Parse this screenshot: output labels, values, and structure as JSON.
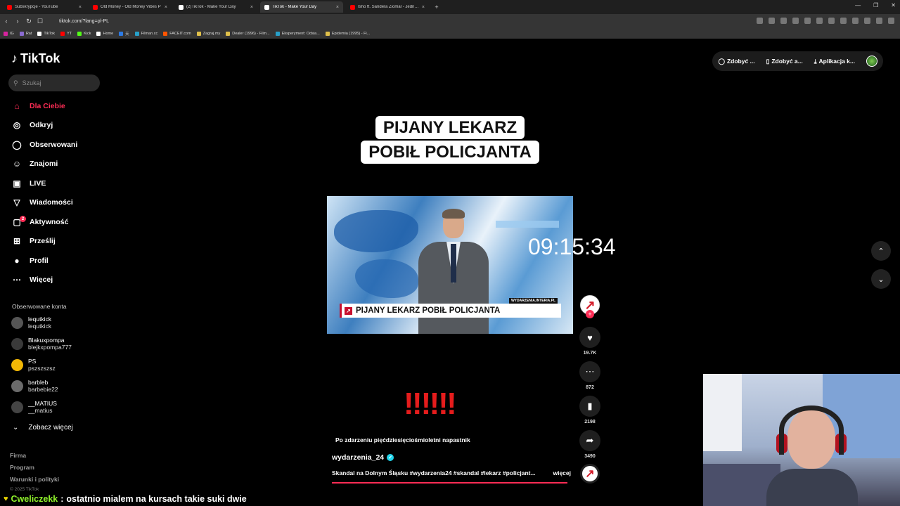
{
  "browser": {
    "tabs": [
      {
        "title": "Subskrypcje - YouTube",
        "color": "#ff0000"
      },
      {
        "title": "Old Money - Old Money Vibes P",
        "color": "#ff0000"
      },
      {
        "title": "(2)TikTok - Make Your Day",
        "color": "#ffffff"
      },
      {
        "title": "TikTok - Make Your Day",
        "color": "#ffffff"
      },
      {
        "title": "Isho ft. Sandera Ziomal - Jednorazów",
        "color": "#ff0000"
      }
    ],
    "new_tab_symbol": "+",
    "url": "tiktok.com/?lang=pl-PL",
    "bookmarks": [
      {
        "label": "IG",
        "color": "#d6249f"
      },
      {
        "label": "Rat",
        "color": "#8a6bd1"
      },
      {
        "label": "TikTok",
        "color": "#ffffff"
      },
      {
        "label": "YT",
        "color": "#ff0000"
      },
      {
        "label": "Kick",
        "color": "#53fc18"
      },
      {
        "label": "Home",
        "color": "#ffffff"
      },
      {
        "label": "天",
        "color": "#2d7be5"
      },
      {
        "label": "Filman.cc",
        "color": "#27a0c9"
      },
      {
        "label": "FACEIT.com",
        "color": "#ff5500"
      },
      {
        "label": "Zagraj.my",
        "color": "#e0c04a"
      },
      {
        "label": "Dealer (1996) - Film...",
        "color": "#e0c04a"
      },
      {
        "label": "Eksperyment: Odsia...",
        "color": "#27a0c9"
      },
      {
        "label": "Epidemia (1995) - Fi...",
        "color": "#e0c04a"
      }
    ]
  },
  "tiktok": {
    "logo": "TikTok",
    "search_placeholder": "Szukaj",
    "nav": [
      {
        "label": "Dla Ciebie",
        "icon": "home-icon",
        "glyph": "⌂",
        "active": true
      },
      {
        "label": "Odkryj",
        "icon": "compass-icon",
        "glyph": "◎"
      },
      {
        "label": "Obserwowani",
        "icon": "following-icon",
        "glyph": "◯"
      },
      {
        "label": "Znajomi",
        "icon": "friends-icon",
        "glyph": "☺"
      },
      {
        "label": "LIVE",
        "icon": "live-icon",
        "glyph": "▣"
      },
      {
        "label": "Wiadomości",
        "icon": "messages-icon",
        "glyph": "▽"
      },
      {
        "label": "Aktywność",
        "icon": "activity-icon",
        "glyph": "▢",
        "badge": "2"
      },
      {
        "label": "Prześlij",
        "icon": "upload-icon",
        "glyph": "⊞"
      },
      {
        "label": "Profil",
        "icon": "profile-icon",
        "glyph": "●"
      },
      {
        "label": "Więcej",
        "icon": "more-icon",
        "glyph": "⋯"
      }
    ],
    "following_title": "Obserwowane konta",
    "following": [
      {
        "name": "lequtkick",
        "handle": "lequtkick"
      },
      {
        "name": "Blakuxpompa",
        "handle": "blejkxpompa777"
      },
      {
        "name": "PS",
        "handle": "pszszszsz"
      },
      {
        "name": "barbleb",
        "handle": "barbebie22"
      },
      {
        "name": "__MATIUS",
        "handle": "__matius"
      }
    ],
    "see_more": "Zobacz więcej",
    "footer": [
      "Firma",
      "Program",
      "Warunki i polityki"
    ],
    "copyright": "© 2025 TikTok",
    "header_buttons": [
      "Zdobyć ...",
      "Zdobyć a...",
      "Aplikacja k..."
    ]
  },
  "video": {
    "headline_line1": "PIJANY LEKARZ",
    "headline_line2": "POBIŁ POLICJANTA",
    "ticker": "PIJANY LEKARZ POBIŁ POLICJANTA",
    "ticker_source": "WYDARZENIA.INTERIA.PL",
    "exclamations": "‼‼‼",
    "subtitle": "Po zdarzeniu pięćdziesięciośmioletni napastnik",
    "author": "wydarzenia_24",
    "description": "Skandal na Dolnym Śląsku #wydarzenia24 #skandal #lekarz #policjant...",
    "more": "więcej",
    "progress": 0.99,
    "likes": "19.7K",
    "comments": "872",
    "saves": "2198",
    "shares": "3490"
  },
  "overlay": {
    "clock": "09:15:34",
    "chat_user": "Cweliczekk",
    "chat_sep": ":",
    "chat_message": "ostatnio mialem na kursach takie suki dwie"
  }
}
